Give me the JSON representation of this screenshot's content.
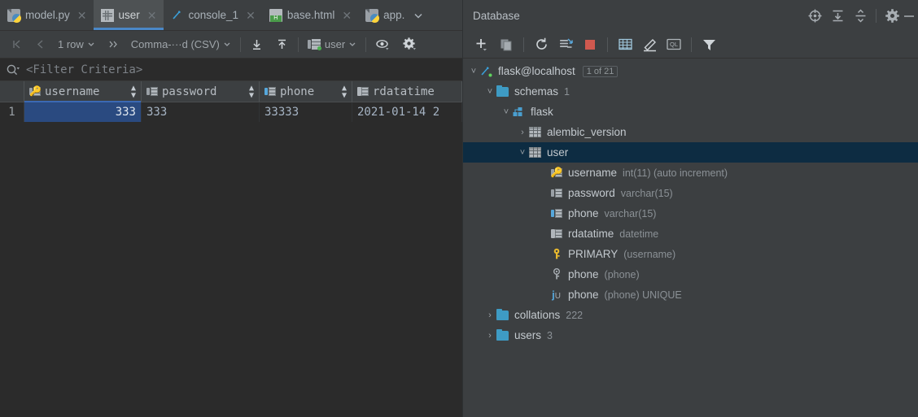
{
  "editor": {
    "tabs": [
      {
        "label": "model.py",
        "icon": "python-file-icon",
        "active": false,
        "closable": true
      },
      {
        "label": "user",
        "icon": "table-icon",
        "active": true,
        "closable": true
      },
      {
        "label": "console_1",
        "icon": "console-icon",
        "active": false,
        "closable": true
      },
      {
        "label": "base.html",
        "icon": "html-file-icon",
        "active": false,
        "closable": true
      },
      {
        "label": "app.",
        "icon": "python-file-icon",
        "active": false,
        "closable": false
      }
    ],
    "tab_overflow_icon": "chevron-down-icon",
    "toolbar": {
      "first_page_icon": "first-page-icon",
      "prev_page_icon": "prev-page-icon",
      "row_count": "1 row",
      "row_count_caret": "chevron-down-icon",
      "next_page_icon": "next-page-icon",
      "format": "Comma-···d (CSV)",
      "format_caret": "chevron-down-icon",
      "import_icon": "download-icon",
      "export_icon": "upload-icon",
      "session": "user",
      "session_icon": "db-session-icon",
      "session_caret": "chevron-down-icon",
      "view_icon": "eye-icon",
      "settings_icon": "gear-icon"
    },
    "filter": {
      "icon": "search-icon",
      "placeholder": "<Filter Criteria>"
    },
    "grid": {
      "columns": [
        {
          "name": "username",
          "icon": "column-key-icon",
          "sortable": true
        },
        {
          "name": "password",
          "icon": "column-icon",
          "sortable": true
        },
        {
          "name": "phone",
          "icon": "column-indexed-icon",
          "sortable": true
        },
        {
          "name": "rdatatime",
          "icon": "column-plain-icon",
          "sortable": false
        }
      ],
      "rows": [
        {
          "number": "1",
          "username": "333",
          "password": "333",
          "phone": "33333",
          "rdatatime": "2021-01-14 2"
        }
      ]
    }
  },
  "database": {
    "title": "Database",
    "header_actions": [
      {
        "icon": "locate-icon"
      },
      {
        "icon": "expand-all-icon"
      },
      {
        "icon": "collapse-all-icon"
      },
      {
        "icon": "gear-icon"
      },
      {
        "icon": "minimize-icon"
      }
    ],
    "toolbar": [
      {
        "icon": "add-icon"
      },
      {
        "icon": "copy-icon"
      },
      {
        "icon": "refresh-icon"
      },
      {
        "icon": "sync-icon"
      },
      {
        "icon": "stop-icon"
      },
      {
        "icon": "table-icon"
      },
      {
        "icon": "edit-icon"
      },
      {
        "icon": "ql-console-icon"
      },
      {
        "icon": "filter-icon"
      }
    ],
    "tree": [
      {
        "depth": 0,
        "arrow": "expanded",
        "icon": "datasource-icon",
        "label": "flask@localhost",
        "badge": "1 of 21",
        "meta": "",
        "selected": false
      },
      {
        "depth": 1,
        "arrow": "expanded",
        "icon": "folder-icon",
        "label": "schemas",
        "badge": "",
        "meta": "1",
        "selected": false
      },
      {
        "depth": 2,
        "arrow": "expanded",
        "icon": "schema-icon",
        "label": "flask",
        "badge": "",
        "meta": "",
        "selected": false
      },
      {
        "depth": 3,
        "arrow": "collapsed",
        "icon": "table-icon",
        "label": "alembic_version",
        "badge": "",
        "meta": "",
        "selected": false
      },
      {
        "depth": 3,
        "arrow": "expanded",
        "icon": "table-icon",
        "label": "user",
        "badge": "",
        "meta": "",
        "selected": true
      },
      {
        "depth": 4,
        "arrow": "none",
        "icon": "column-key-icon",
        "label": "username",
        "badge": "",
        "meta": "int(11) (auto increment)",
        "selected": false
      },
      {
        "depth": 4,
        "arrow": "none",
        "icon": "column-icon",
        "label": "password",
        "badge": "",
        "meta": "varchar(15)",
        "selected": false
      },
      {
        "depth": 4,
        "arrow": "none",
        "icon": "column-indexed-icon",
        "label": "phone",
        "badge": "",
        "meta": "varchar(15)",
        "selected": false
      },
      {
        "depth": 4,
        "arrow": "none",
        "icon": "column-plain-icon",
        "label": "rdatatime",
        "badge": "",
        "meta": "datetime",
        "selected": false
      },
      {
        "depth": 4,
        "arrow": "none",
        "icon": "primary-key-icon",
        "label": "PRIMARY",
        "badge": "",
        "meta": "(username)",
        "selected": false
      },
      {
        "depth": 4,
        "arrow": "none",
        "icon": "index-key-icon",
        "label": "phone",
        "badge": "",
        "meta": "(phone)",
        "selected": false
      },
      {
        "depth": 4,
        "arrow": "none",
        "icon": "unique-index-icon",
        "label": "phone",
        "badge": "",
        "meta": "(phone) UNIQUE",
        "selected": false
      },
      {
        "depth": 1,
        "arrow": "collapsed",
        "icon": "folder-icon",
        "label": "collations",
        "badge": "",
        "meta": "222",
        "selected": false
      },
      {
        "depth": 1,
        "arrow": "collapsed",
        "icon": "folder-icon",
        "label": "users",
        "badge": "",
        "meta": "3",
        "selected": false
      }
    ]
  },
  "colors": {
    "background": "#3c3f41",
    "editor_bg": "#2b2b2b",
    "selected_cell": "#2a4a80",
    "selected_tree_row": "#0d2c42",
    "accent_tab_underline": "#4a88c7",
    "key_yellow": "#e8b92e",
    "folder_blue": "#3e9bc4",
    "stop_red": "#d0594f"
  }
}
